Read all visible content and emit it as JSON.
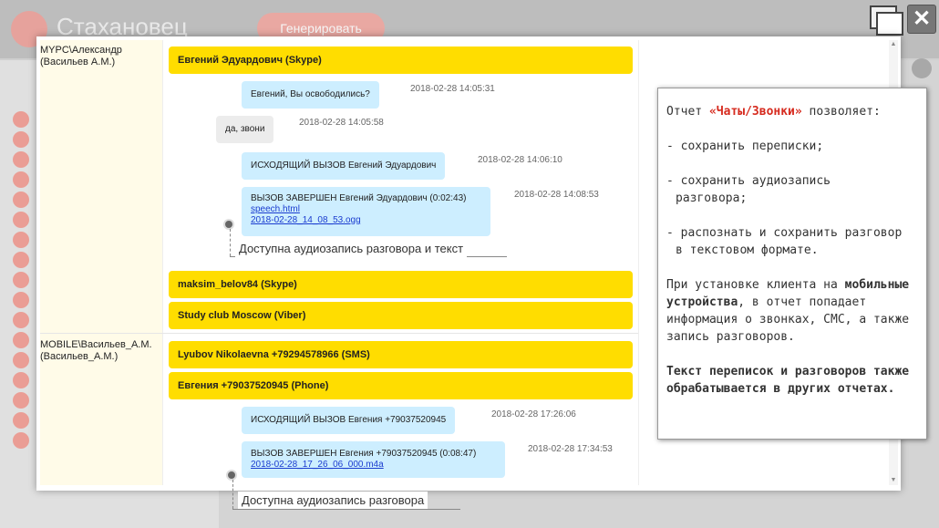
{
  "background": {
    "app_title": "Стахановец",
    "generate_button": "Генерировать"
  },
  "window": {
    "close_glyph": "✕"
  },
  "contacts": [
    {
      "line1": "MYPC\\Александр",
      "line2": "(Васильев А.М.)"
    },
    {
      "line1": "MOBILE\\Васильев_А.М.",
      "line2": "(Васильев_А.М.)"
    }
  ],
  "chats": {
    "chat1": "Евгений Эдуардович (Skype)",
    "chat2": "maksim_belov84 (Skype)",
    "chat3": "Study club Moscow (Viber)",
    "chat4": "Lyubov Nikolaevna +79294578966 (SMS)",
    "chat5": "Евгения +79037520945 (Phone)"
  },
  "messages": {
    "m1": {
      "text": "Евгений, Вы освободились?",
      "time": "2018-02-28 14:05:31"
    },
    "m2": {
      "text": "да, звони",
      "time": "2018-02-28 14:05:58"
    },
    "m3": {
      "text": "ИСХОДЯЩИЙ ВЫЗОВ Евгений Эдуардович",
      "time": "2018-02-28 14:06:10"
    },
    "m4": {
      "text": "ВЫЗОВ ЗАВЕРШЕН Евгений Эдуардович (0:02:43)",
      "link1": "speech.html",
      "link2": "2018-02-28_14_08_53.ogg",
      "time": "2018-02-28 14:08:53"
    },
    "m5": {
      "text": "ИСХОДЯЩИЙ ВЫЗОВ Евгения +79037520945",
      "time": "2018-02-28 17:26:06"
    },
    "m6": {
      "text": "ВЫЗОВ ЗАВЕРШЕН Евгения +79037520945 (0:08:47)",
      "link1": "2018-02-28_17_26_06_000.m4a",
      "time": "2018-02-28 17:34:53"
    }
  },
  "callouts": {
    "c1": "Доступна аудиозапись разговора и текст",
    "c2": "Доступна аудиозапись разговора"
  },
  "info": {
    "p1_pre": "Отчет ",
    "p1_red": "«Чаты/Звонки»",
    "p1_post": " позволяет:",
    "b1": "- сохранить переписки;",
    "b2a": "- сохранить аудиозапись",
    "b2b": "разговора;",
    "b3a": "- распознать и сохранить разговор",
    "b3b": "в текстовом формате.",
    "p2_pre": "При установке клиента на ",
    "p2_bold": "мобильные устройства",
    "p2_post": ", в отчет попадает информация о звонках, СМС, а также запись разговоров.",
    "p3": "Текст переписок и разговоров также обрабатывается в других отчетах."
  },
  "colors": {
    "chat_bar": "#ffdd00",
    "bubble_out": "#cdeeff",
    "bubble_in": "#ececec",
    "accent_red": "#d62b1f"
  }
}
